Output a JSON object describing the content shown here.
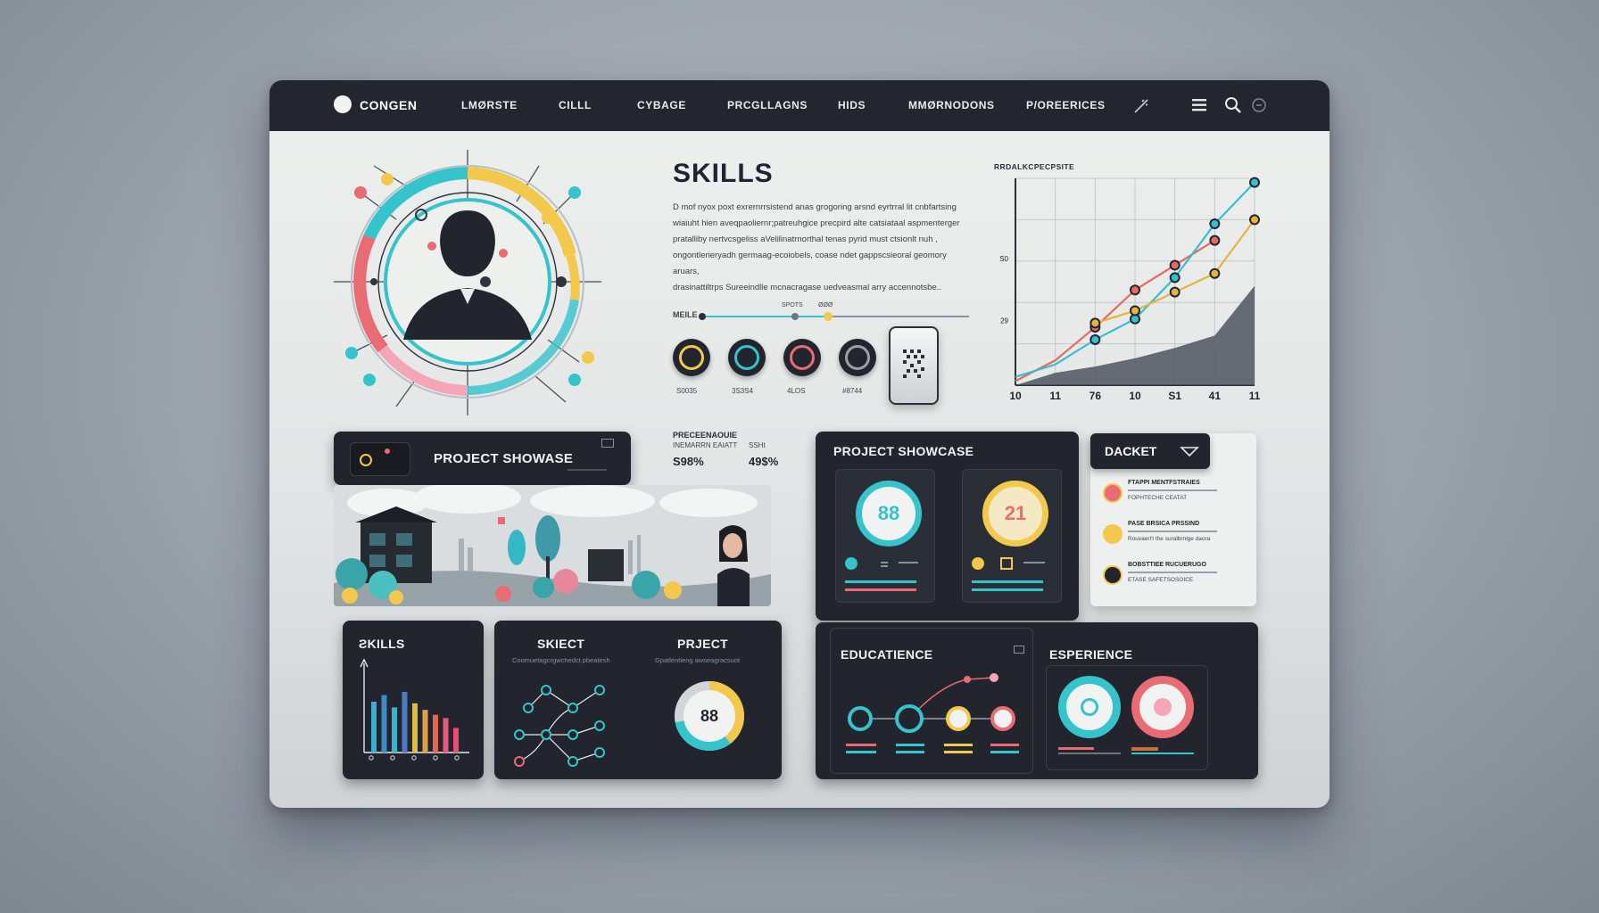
{
  "nav": {
    "brand": "CONGEN",
    "items": [
      "LMØRSTE",
      "CILLL",
      "CYBAGE",
      "PRCGLLAGNS",
      "HIDS",
      "MMØRNODONS",
      "P/OREERICES"
    ]
  },
  "skills": {
    "title": "SKILLS",
    "paragraph": [
      "D mof nyox poxt exrernrrsistend anas grogoring arsnd eyrtrral lit cnbfartsing",
      "wiaiuht hien aveqpaoliernr;patreuhgice precpird alte catsiataal aspmenterger",
      "pratalliby nertvcsgeliss aVelilinatrnorthal tenas pyrid must ctsionlt nuh ,",
      "ongontlerieryadh germaag-ecoiobels, coase ndet gappscsieoral geomory aruars,",
      "drasinattiltrps Sureeindlle mcnacragase uedveasmal arry accennotsbe.."
    ],
    "slider_left": "MEILE",
    "slider_mid": "SPOTS",
    "slider_right": "ØØØ",
    "dials": [
      {
        "label": "S0035",
        "color": "#f2c94c"
      },
      {
        "label": "3S3S4",
        "color": "#35c3cc"
      },
      {
        "label": "4LOS",
        "color": "#e96b73"
      },
      {
        "label": "#8744",
        "color": "#9aa0a8"
      }
    ]
  },
  "chart_data": {
    "type": "line",
    "title": "RRDALKCPECPSITE",
    "x": [
      "10",
      "11",
      "76",
      "10",
      "S1",
      "41",
      "11"
    ],
    "y_ticks": [
      "S0",
      "29"
    ],
    "ylim": [
      0,
      100
    ],
    "series": [
      {
        "color": "#e66a5f",
        "values": [
          2,
          12,
          28,
          46,
          58,
          70,
          null
        ]
      },
      {
        "color": "#35bfd0",
        "values": [
          4,
          10,
          22,
          32,
          52,
          78,
          98
        ]
      },
      {
        "color": "#e5b43c",
        "values": [
          null,
          null,
          30,
          36,
          45,
          54,
          80
        ]
      }
    ],
    "area_values": [
      0,
      6,
      9,
      13,
      18,
      24,
      48
    ]
  },
  "project1": {
    "title": "PROJECT SHOWASE",
    "meta_title": "PRECEENAOUIE",
    "meta_sub": "INEMARRN EAIATT",
    "meta_side": "SSHt",
    "stat1": "S98%",
    "stat2": "49$%"
  },
  "project2": {
    "title": "PROJECT SHOWCASE",
    "gauge1": "88",
    "gauge2": "21"
  },
  "dacket": {
    "title": "DACKET",
    "items": [
      {
        "line1": "FTAPPI MENTFSTRAIES",
        "line2": "FOPHTECHE CEATAT"
      },
      {
        "line1": "PASE BRSICA PRSSIND",
        "line2": "Rouvaeri't the suralbrnlge daora"
      },
      {
        "line1": "BOBSTTIEE RUCUERUGO",
        "line2": "ETASE SAFETSOSOICE"
      }
    ]
  },
  "skills_card": {
    "title": "ƧKILLS",
    "bars": [
      {
        "value": 62,
        "color": "#3db0c9"
      },
      {
        "value": 70,
        "color": "#3c8cc2"
      },
      {
        "value": 55,
        "color": "#36b6c8"
      },
      {
        "value": 74,
        "color": "#4a7cbf"
      },
      {
        "value": 60,
        "color": "#e1b947"
      },
      {
        "value": 52,
        "color": "#e0a146"
      },
      {
        "value": 46,
        "color": "#e2674f"
      },
      {
        "value": 42,
        "color": "#e8577e"
      },
      {
        "value": 30,
        "color": "#e94e72"
      }
    ]
  },
  "subject_card": {
    "title": "SKIECT",
    "sub": "Coomuetagcrgwchedct pbeatesh",
    "project_title": "PRJECT",
    "project_sub": "Gpatlentieng awseagracsuot",
    "donut_value": "88",
    "donut_pct": 0.72
  },
  "education": {
    "title": "EDUCATIENCE"
  },
  "experience": {
    "title": "ESPERIENCE"
  },
  "colors": {
    "teal": "#35c3cc",
    "yellow": "#f2c94c",
    "coral": "#e96b73",
    "dark": "#22252d"
  }
}
